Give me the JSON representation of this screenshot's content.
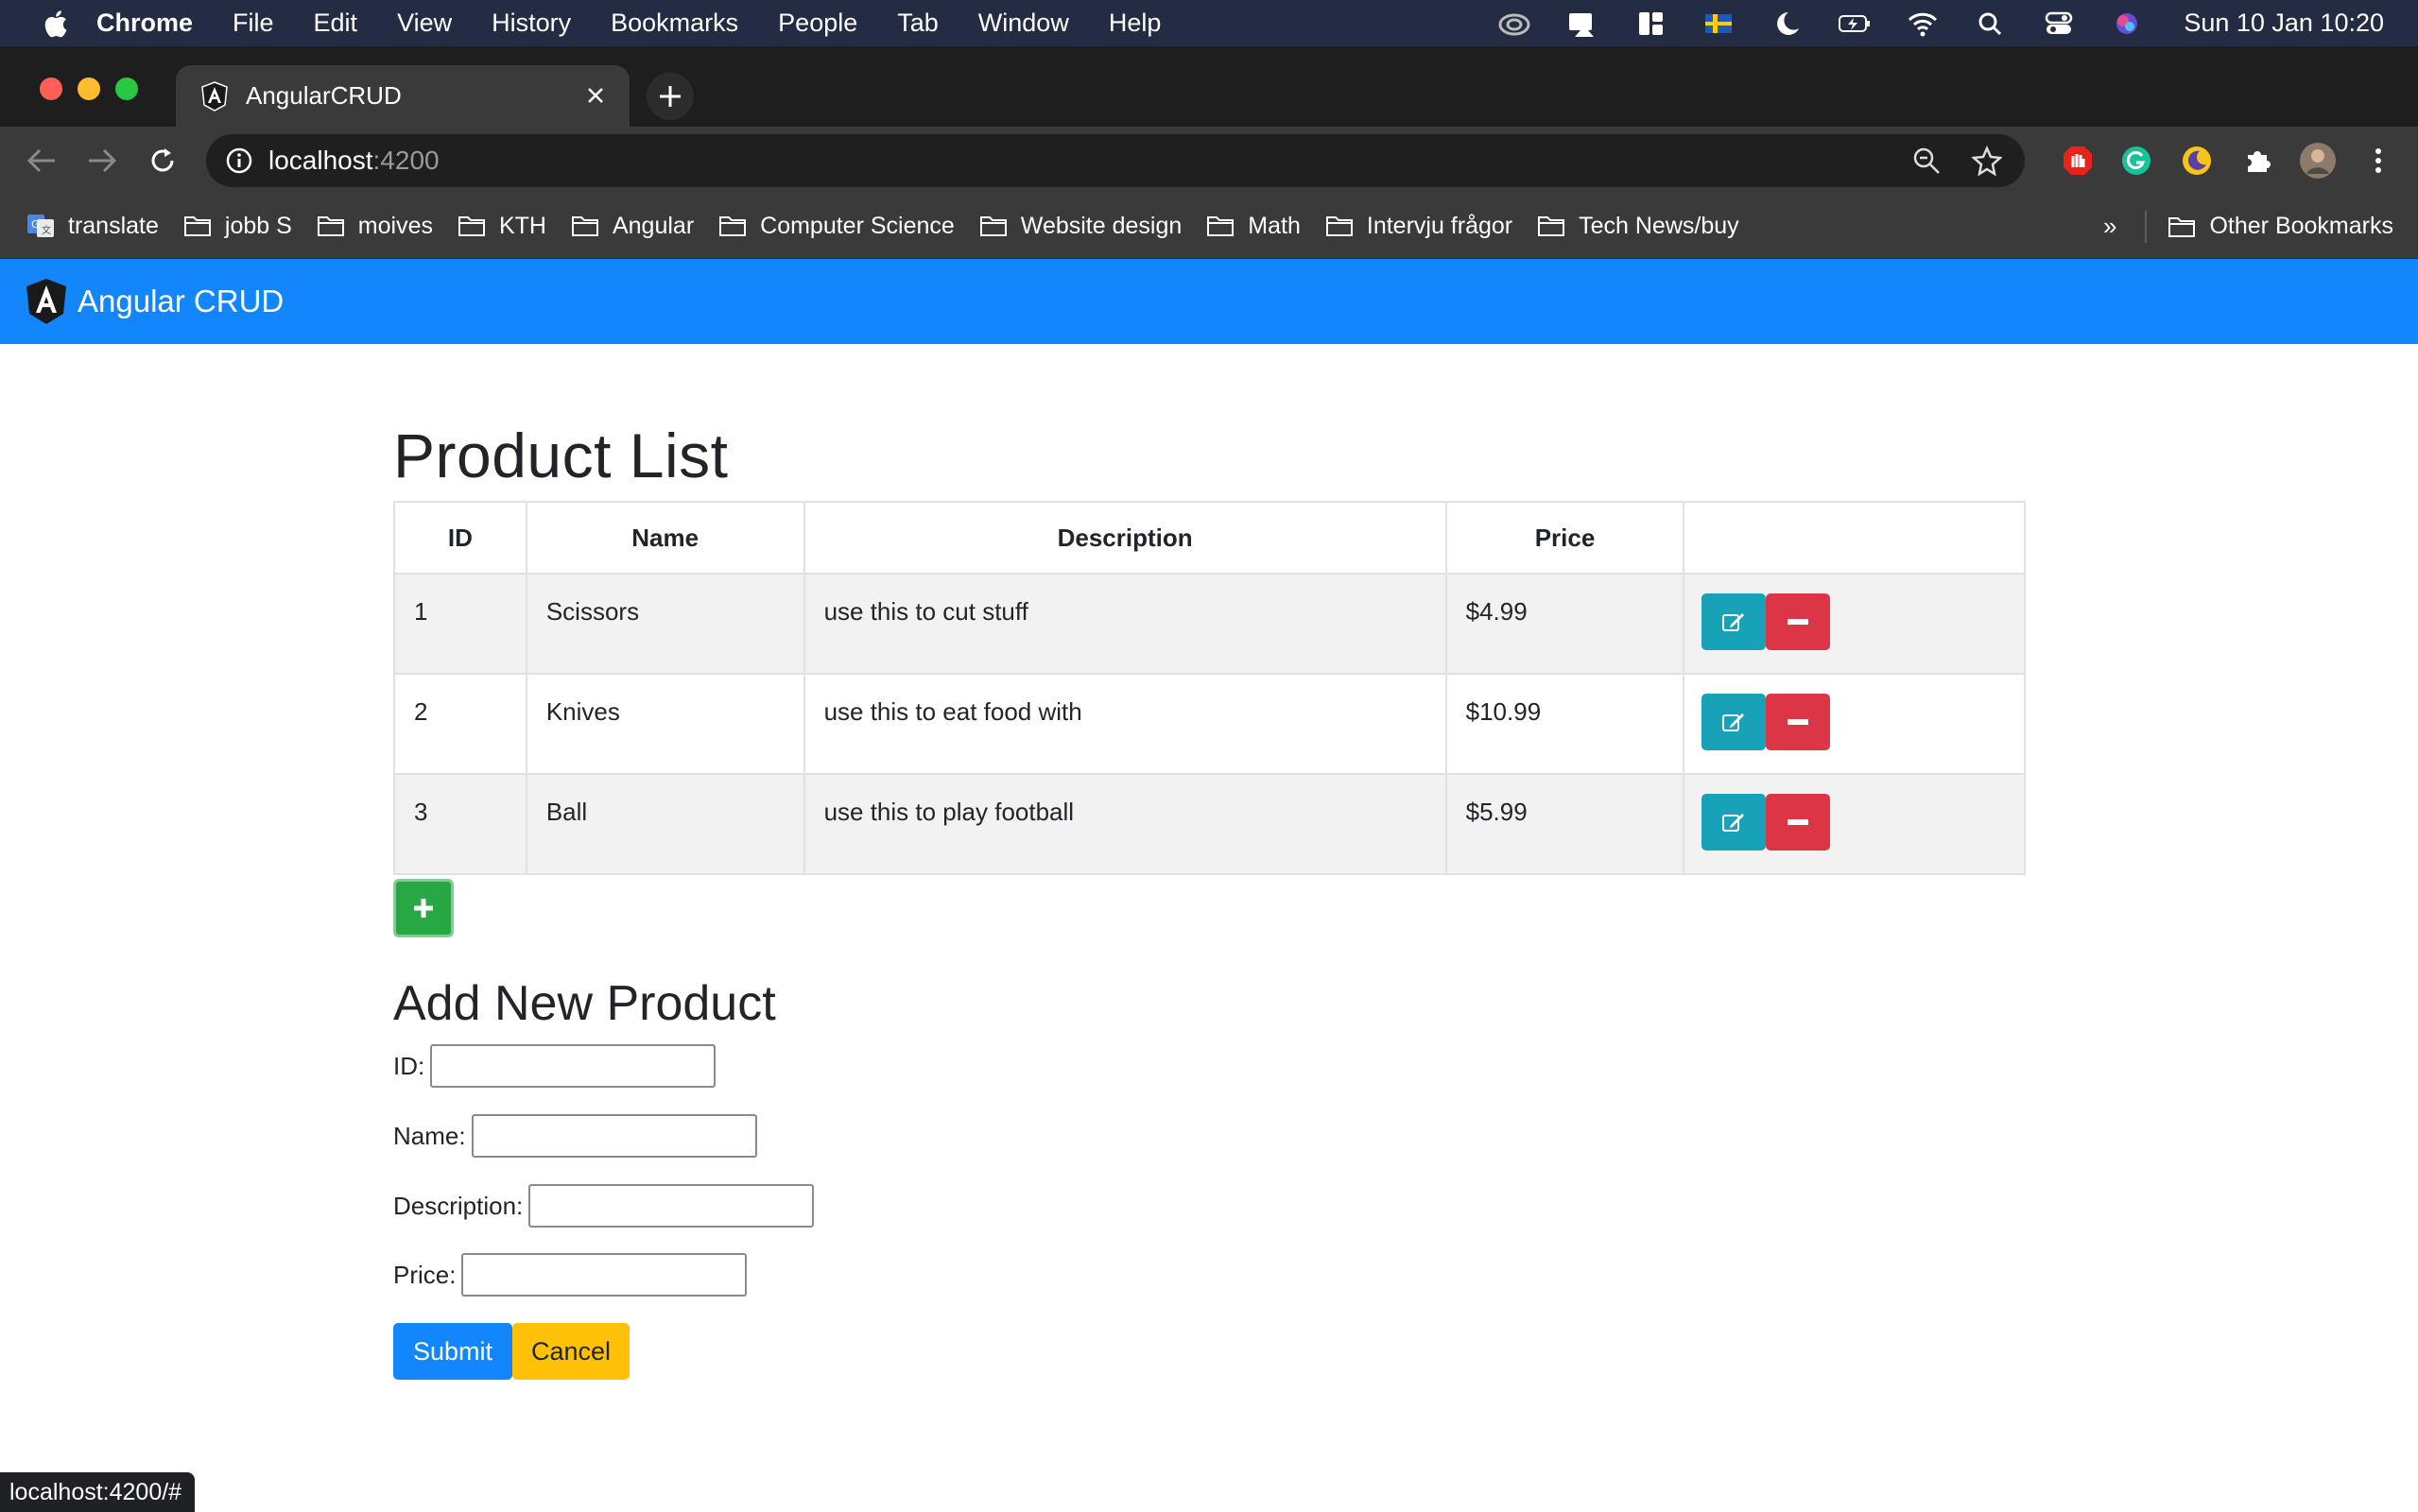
{
  "menubar": {
    "app": "Chrome",
    "items": [
      "File",
      "Edit",
      "View",
      "History",
      "Bookmarks",
      "People",
      "Tab",
      "Window",
      "Help"
    ],
    "clock": "Sun 10 Jan  10:20"
  },
  "browser": {
    "tab_title": "AngularCRUD",
    "url_host": "localhost",
    "url_port": ":4200",
    "bookmarks": [
      "translate",
      "jobb S",
      "moives",
      "KTH",
      "Angular",
      "Computer Science",
      "Website design",
      "Math",
      "Intervju frågor",
      "Tech News/buy"
    ],
    "more_bookmarks": "»",
    "other_bookmarks": "Other Bookmarks"
  },
  "app": {
    "brand": "Angular CRUD",
    "list_title": "Product List",
    "columns": [
      "ID",
      "Name",
      "Description",
      "Price",
      ""
    ],
    "products": [
      {
        "id": "1",
        "name": "Scissors",
        "description": "use this to cut stuff",
        "price": "$4.99"
      },
      {
        "id": "2",
        "name": "Knives",
        "description": "use this to eat food with",
        "price": "$10.99"
      },
      {
        "id": "3",
        "name": "Ball",
        "description": "use this to play football",
        "price": "$5.99"
      }
    ],
    "add_symbol": "+",
    "form_title": "Add New Product",
    "form": {
      "id_label": "ID:",
      "name_label": "Name:",
      "description_label": "Description:",
      "price_label": "Price:",
      "submit_label": "Submit",
      "cancel_label": "Cancel"
    }
  },
  "statusbar": {
    "url": "localhost:4200/#"
  },
  "colors": {
    "navbar": "#1486fd",
    "edit": "#17a2b8",
    "delete": "#dc3545",
    "add": "#28a745",
    "submit": "#1486fd",
    "cancel": "#ffc107"
  }
}
